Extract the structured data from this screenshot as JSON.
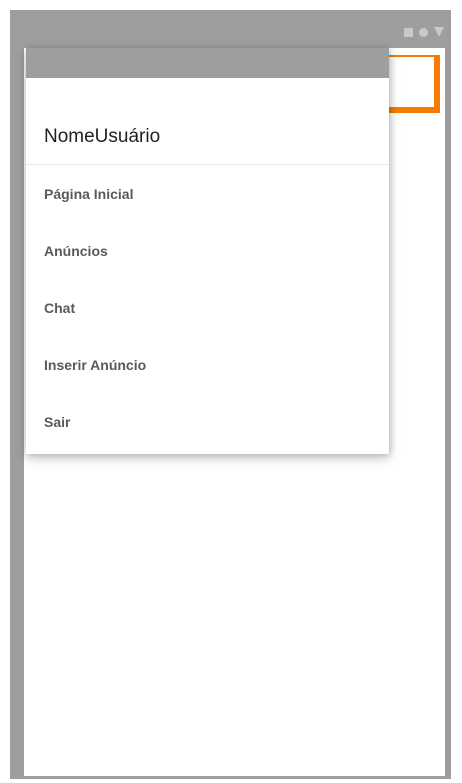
{
  "drawer": {
    "user_name": "NomeUsuário",
    "items": [
      {
        "label": "Página Inicial"
      },
      {
        "label": "Anúncios"
      },
      {
        "label": "Chat"
      },
      {
        "label": "Inserir Anúncio"
      },
      {
        "label": "Sair"
      }
    ]
  },
  "colors": {
    "frame": "#9e9e9e",
    "accent": "#f57c00",
    "background": "#ffffff"
  },
  "status_icons": [
    "square-icon",
    "circle-icon",
    "triangle-down-icon"
  ]
}
